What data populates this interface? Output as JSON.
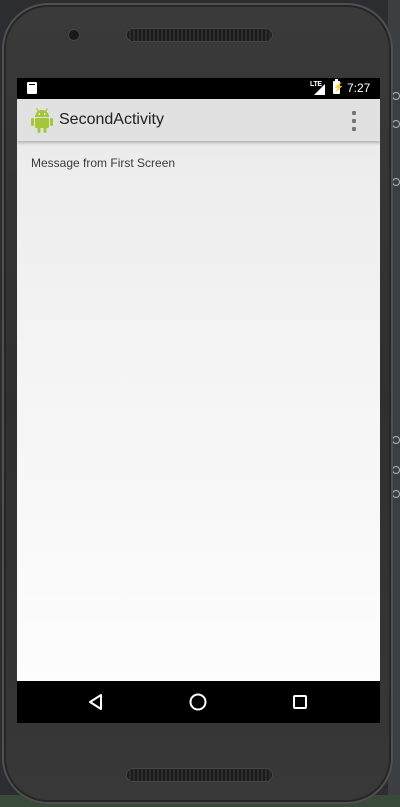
{
  "status_bar": {
    "time": "7:27",
    "network": "LTE",
    "icons": [
      "sd-card-icon",
      "lte-signal-icon",
      "battery-charging-icon"
    ]
  },
  "action_bar": {
    "title": "SecondActivity",
    "icons": [
      "android-logo-icon",
      "overflow-menu-icon"
    ]
  },
  "content": {
    "message": "Message from First Screen"
  },
  "nav_bar": {
    "icons": [
      "back-icon",
      "home-icon",
      "recents-icon"
    ]
  },
  "colors": {
    "action_bar_bg": "#e1e1e1",
    "android_green": "#a4c639",
    "status_bar_bg": "#000000"
  }
}
